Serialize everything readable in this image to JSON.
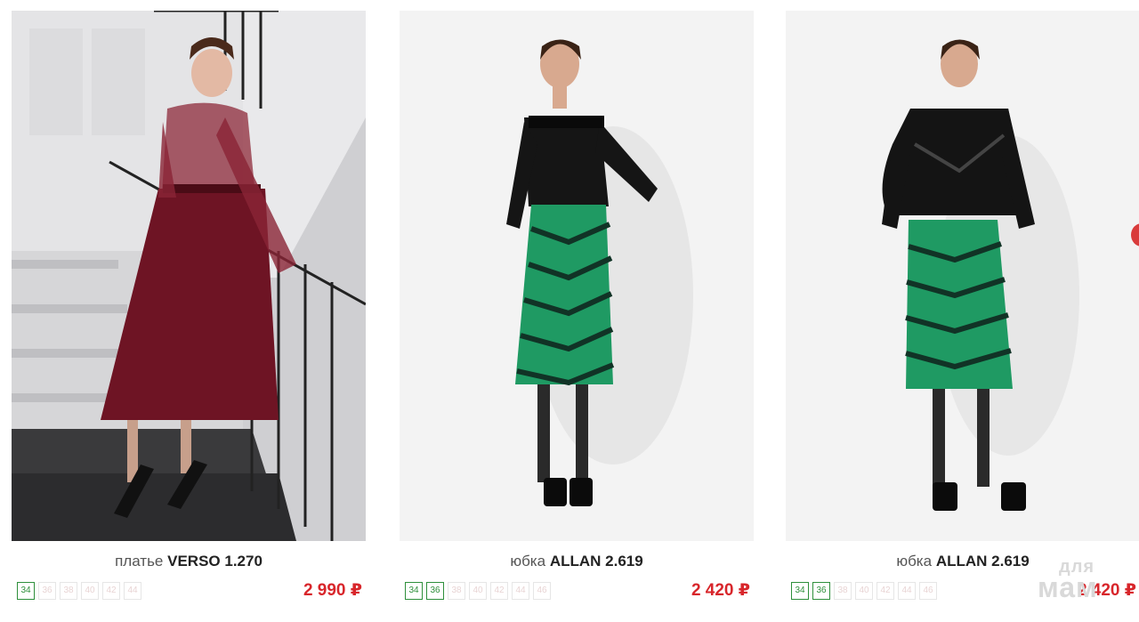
{
  "products": [
    {
      "type": "платье",
      "name": "VERSO 1.270",
      "price": "2 990 ₽",
      "sizes": [
        {
          "label": "34",
          "available": true
        },
        {
          "label": "36",
          "available": false
        },
        {
          "label": "38",
          "available": false
        },
        {
          "label": "40",
          "available": false
        },
        {
          "label": "42",
          "available": false
        },
        {
          "label": "44",
          "available": false
        }
      ]
    },
    {
      "type": "юбка",
      "name": "ALLAN 2.619",
      "price": "2 420 ₽",
      "sizes": [
        {
          "label": "34",
          "available": true
        },
        {
          "label": "36",
          "available": true
        },
        {
          "label": "38",
          "available": false
        },
        {
          "label": "40",
          "available": false
        },
        {
          "label": "42",
          "available": false
        },
        {
          "label": "44",
          "available": false
        },
        {
          "label": "46",
          "available": false
        }
      ]
    },
    {
      "type": "юбка",
      "name": "ALLAN 2.619",
      "price": "2 420 ₽",
      "sizes": [
        {
          "label": "34",
          "available": true
        },
        {
          "label": "36",
          "available": true
        },
        {
          "label": "38",
          "available": false
        },
        {
          "label": "40",
          "available": false
        },
        {
          "label": "42",
          "available": false
        },
        {
          "label": "44",
          "available": false
        },
        {
          "label": "46",
          "available": false
        }
      ]
    }
  ],
  "watermark": {
    "line1": "для",
    "line2": "мам"
  },
  "colors": {
    "price": "#d8262b",
    "size_available": "#2e8f3b",
    "size_unavailable": "#e8d4d4"
  }
}
